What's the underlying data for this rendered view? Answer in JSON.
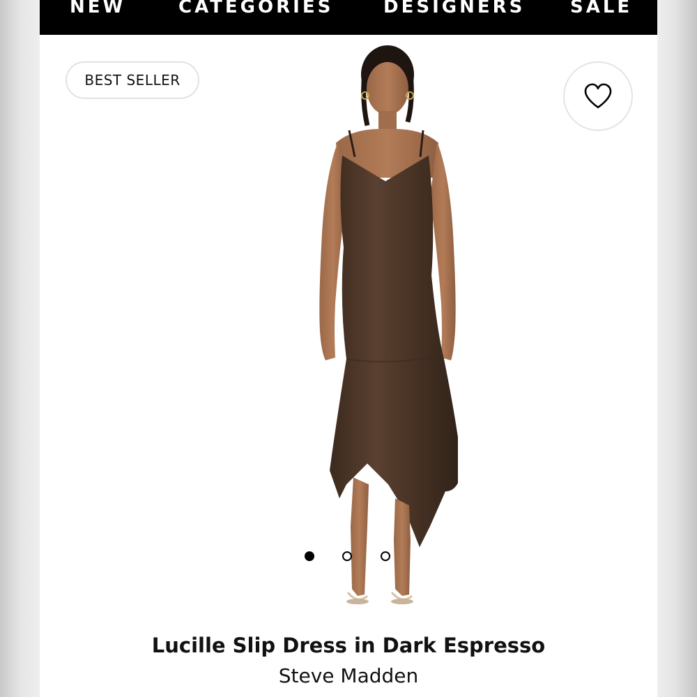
{
  "nav": {
    "items": [
      {
        "label": "NEW"
      },
      {
        "label": "CATEGORIES"
      },
      {
        "label": "DESIGNERS"
      },
      {
        "label": "SALE"
      }
    ]
  },
  "product": {
    "badge": "BEST SELLER",
    "title": "Lucille Slip Dress in Dark Espresso",
    "brand": "Steve Madden",
    "favorite_icon": "heart-outline-icon",
    "image": {
      "subject": "model-wearing-slip-dress",
      "dress_color": "#4a3426"
    },
    "carousel": {
      "total": 3,
      "active_index": 0
    }
  },
  "colors": {
    "nav_background": "#000000",
    "nav_text": "#ffffff",
    "page_background": "#ffffff",
    "text": "#111111"
  }
}
